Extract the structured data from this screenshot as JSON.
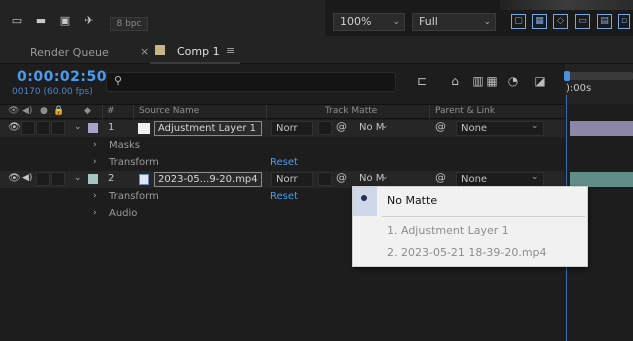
{
  "toolbar": {
    "bpc_label": "8 bpc",
    "zoom": "100%",
    "resolution": "Full"
  },
  "tabs": [
    {
      "label": "Render Queue"
    },
    {
      "label": "Comp 1",
      "close_glyph": "×",
      "menu_glyph": "≡"
    }
  ],
  "timeline": {
    "timecode": "0:00:02:50",
    "frame_info": "00170 (60.00 fps)",
    "ruler_label": "):00s"
  },
  "columns": {
    "hash": "#",
    "source_name": "Source Name",
    "track_matte": "Track Matte",
    "parent_link": "Parent & Link"
  },
  "layers": [
    {
      "number": "1",
      "name": "Adjustment Layer 1",
      "mode": "Norr",
      "matte": "No M",
      "parent": "None",
      "label_color": "#a5a5c9",
      "bar_color": "#8a88a8",
      "subs": [
        {
          "label": "Masks",
          "reset": ""
        },
        {
          "label": "Transform",
          "reset": "Reset"
        }
      ]
    },
    {
      "number": "2",
      "name": "2023-05...9-20.mp4",
      "mode": "Norr",
      "matte": "No M",
      "parent": "None",
      "label_color": "#9fc7c0",
      "bar_color": "#5f8e86",
      "subs": [
        {
          "label": "Transform",
          "reset": "Reset"
        },
        {
          "label": "Audio",
          "reset": ""
        }
      ]
    }
  ],
  "matte_popup": {
    "items": [
      {
        "label": "No Matte",
        "selected": true
      },
      {
        "label": "1. Adjustment Layer 1",
        "selected": false
      },
      {
        "label": "2. 2023-05-21 18-39-20.mp4",
        "selected": false
      }
    ]
  },
  "colors": {
    "accent": "#4a9cf2",
    "panel": "#1d1d1d"
  }
}
